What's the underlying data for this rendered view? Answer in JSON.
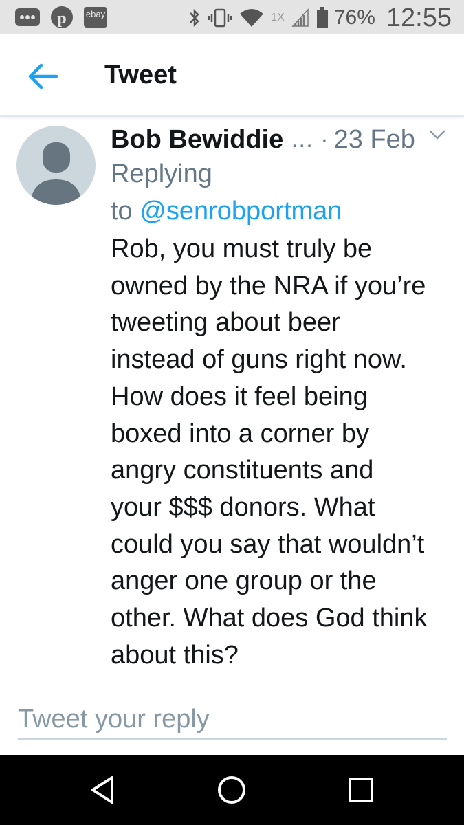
{
  "status_bar": {
    "notifications": [
      "more-icon",
      "pinterest-icon",
      "ebay-icon"
    ],
    "ebay_label": "ebay",
    "network_badge": "1X",
    "battery": "76%",
    "time": "12:55"
  },
  "header": {
    "title": "Tweet"
  },
  "tweet": {
    "author_name": "Bob Bewiddie",
    "truncation": "…",
    "separator": "·",
    "date": "23 Feb",
    "replying_prefix_1": "Replying",
    "replying_prefix_2": "to",
    "replying_handle": "@senrobportman",
    "text": "Rob, you must truly be\nowned by the NRA if you’re\ntweeting about beer\ninstead of guns right now.\nHow does it feel being\nboxed into a corner by\nangry constituents and\nyour $$$ donors. What\ncould you say that wouldn’t\nanger one group or the\nother. What does God think\nabout this?"
  },
  "reply": {
    "placeholder": "Tweet your reply"
  },
  "colors": {
    "accent": "#1da1f2",
    "status_bar_bg": "#e4e4e4",
    "secondary_text": "#657786",
    "avatar_bg": "#ccd6dd",
    "avatar_fg": "#66757f"
  }
}
